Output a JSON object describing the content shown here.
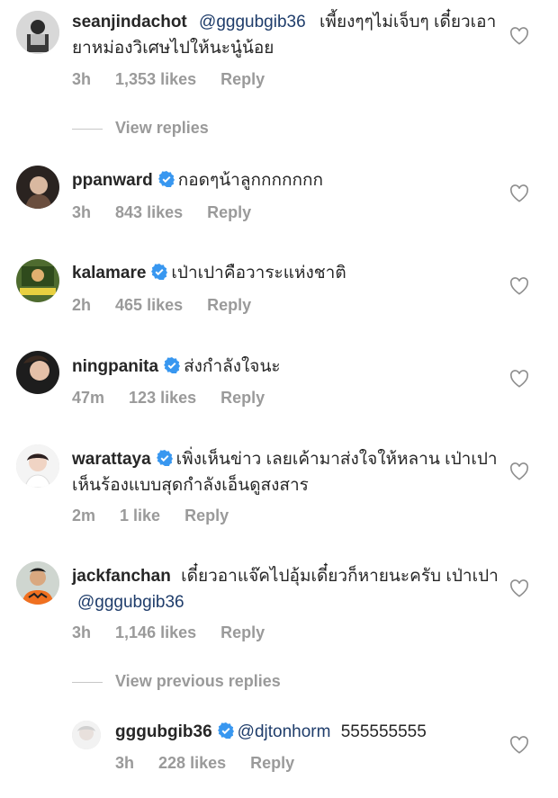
{
  "comments": [
    {
      "username": "seanjindachot",
      "verified": false,
      "mention": "@gggubgib36",
      "text": "เพี้ยงๆๆไม่เจ็บๆ เดี๋ยวเอายาหม่องวิเศษไปให้นะนู๋น้อย",
      "time": "3h",
      "likes": "1,353 likes",
      "reply": "Reply"
    },
    {
      "username": "ppanward",
      "verified": true,
      "mention": "",
      "text": "กอดๆน้าลูกกกกกกก",
      "time": "3h",
      "likes": "843 likes",
      "reply": "Reply"
    },
    {
      "username": "kalamare",
      "verified": true,
      "mention": "",
      "text": "เป่าเปาคือวาระแห่งชาติ",
      "time": "2h",
      "likes": "465 likes",
      "reply": "Reply"
    },
    {
      "username": "ningpanita",
      "verified": true,
      "mention": "",
      "text": "ส่งกำลังใจนะ",
      "time": "47m",
      "likes": "123 likes",
      "reply": "Reply"
    },
    {
      "username": "warattaya",
      "verified": true,
      "mention": "",
      "text": "เพิ่งเห็นข่าว เลยเค้ามาส่งใจให้หลาน เป่าเปา เห็นร้องแบบสุดกำลังเอ็นดูสงสาร",
      "time": "2m",
      "likes": "1 like",
      "reply": "Reply"
    },
    {
      "username": "jackfanchan",
      "verified": false,
      "mention": "@gggubgib36",
      "text": "เดี๋ยวอาแจ๊คไปอุ้มเดี๋ยวก็หายนะครับ เป่าเปา",
      "time": "3h",
      "likes": "1,146 likes",
      "reply": "Reply"
    }
  ],
  "view_replies": "View replies",
  "view_previous_replies": "View previous replies",
  "reply_comment": {
    "username": "gggubgib36",
    "verified": true,
    "mention": "@djtonhorm",
    "text": "555555555",
    "time": "3h",
    "likes": "228 likes",
    "reply": "Reply"
  },
  "colors": {
    "mention": "#1f3d6b",
    "verified": "#3897f0",
    "meta": "#9a9a9a"
  }
}
